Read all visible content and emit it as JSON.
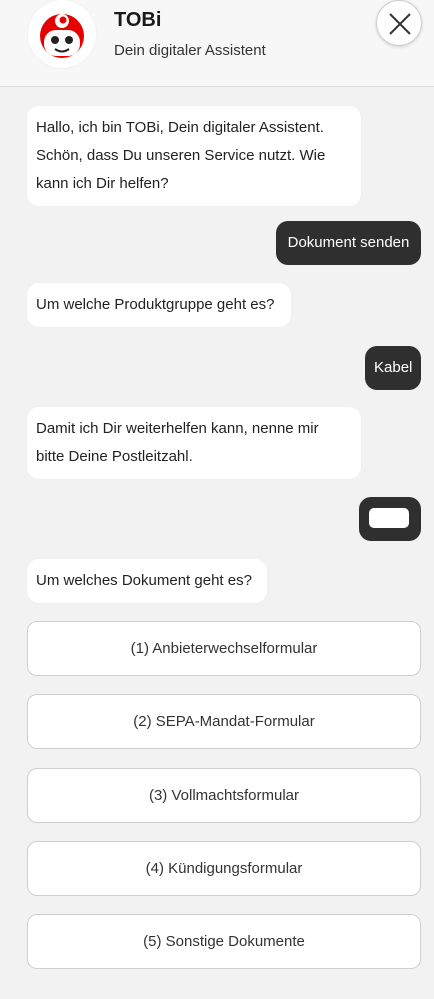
{
  "header": {
    "title": "TOBi",
    "subtitle": "Dein digitaler Assistent",
    "avatar_icon": "tobi-robot-avatar-icon",
    "close_icon": "close-icon"
  },
  "colors": {
    "brand_red": "#e60000",
    "user_bubble": "#2f2f2f",
    "bot_bubble": "#ffffff",
    "background": "#f2f2f2"
  },
  "messages": [
    {
      "from": "bot",
      "text": "Hallo, ich bin TOBi, Dein digitaler Assistent. Schön, dass Du unseren Service nutzt. Wie kann ich Dir helfen?"
    },
    {
      "from": "user",
      "text": "Dokument senden"
    },
    {
      "from": "bot",
      "text": "Um welche Produktgruppe geht es?"
    },
    {
      "from": "user",
      "text": "Kabel"
    },
    {
      "from": "bot",
      "text": "Damit ich Dir weiterhelfen kann, nenne mir bitte Deine Postleitzahl."
    },
    {
      "from": "user",
      "text": ""
    },
    {
      "from": "bot",
      "text": "Um welches Dokument geht es?"
    }
  ],
  "options": [
    "(1) Anbieterwechselformular",
    "(2) SEPA-Mandat-Formular",
    "(3) Vollmachtsformular",
    "(4) Kündigungsformular",
    "(5) Sonstige Dokumente"
  ]
}
